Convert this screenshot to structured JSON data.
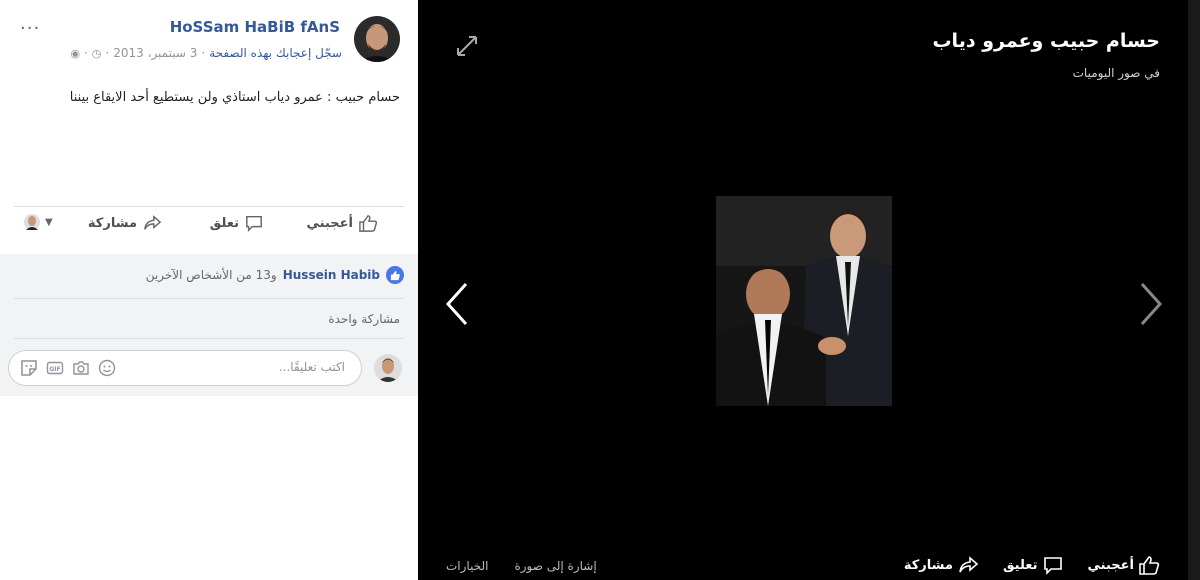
{
  "viewer": {
    "title": "حسام حبيب وعمرو دياب",
    "album": "في صور اليوميات",
    "actions": {
      "like": "أعجبني",
      "comment": "تعليق",
      "share": "مشاركة"
    },
    "links": {
      "options": "الخيارات",
      "tag": "إشارة إلى صورة"
    },
    "icons": [
      "expand-icon",
      "prev-arrow-icon",
      "next-arrow-icon",
      "like-icon",
      "comment-icon",
      "share-icon"
    ]
  },
  "post": {
    "page_name": "HoSSam HaBiB fAnS",
    "meta_like_page": "سجّل إعجابك بهذه الصفحة",
    "meta_date": "3 سبتمبر، 2013",
    "more": "···",
    "text": "حسام حبيب : عمرو دياب استاذي ولن يستطيع أحد الايقاع بيننا",
    "actions": {
      "like": "أعجبني",
      "comment": "تعلق",
      "share": "مشاركة"
    },
    "reactions_name": "Hussein Habib",
    "reactions_others": "و13 من الأشخاص الآخرين",
    "share_count": "مشاركة واحدة",
    "comment_placeholder": "اكتب تعليقًا...",
    "comment_icons": [
      "emoji-icon",
      "camera-icon",
      "gif-icon",
      "sticker-icon"
    ],
    "colors": {
      "link": "#365899",
      "like_badge": "#4a76e8",
      "gray_zone": "#f2f3f5"
    }
  }
}
